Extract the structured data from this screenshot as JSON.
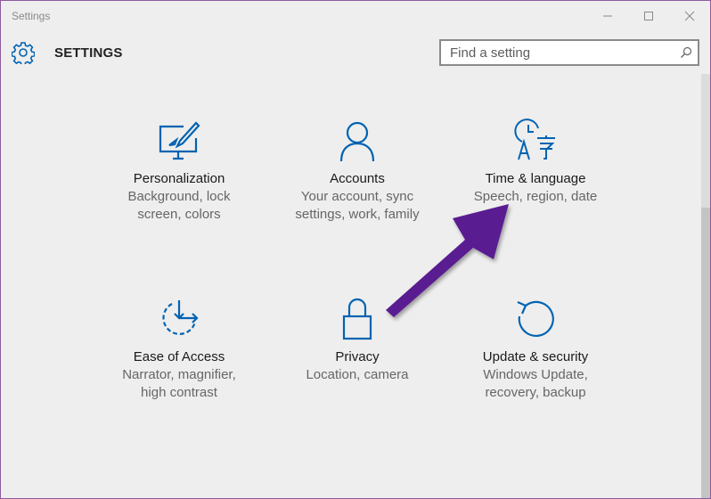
{
  "window": {
    "title": "Settings",
    "controls": [
      "minimize",
      "maximize",
      "close"
    ]
  },
  "header": {
    "title": "SETTINGS",
    "icon": "gear-icon",
    "search": {
      "placeholder": "Find a setting",
      "value": ""
    }
  },
  "tiles": [
    {
      "icon": "personalization-icon",
      "title": "Personalization",
      "desc1": "Background, lock",
      "desc2": "screen, colors"
    },
    {
      "icon": "accounts-icon",
      "title": "Accounts",
      "desc1": "Your account, sync",
      "desc2": "settings, work, family"
    },
    {
      "icon": "time-language-icon",
      "title": "Time & language",
      "desc1": "Speech, region, date",
      "desc2": ""
    },
    {
      "icon": "ease-of-access-icon",
      "title": "Ease of Access",
      "desc1": "Narrator, magnifier,",
      "desc2": "high contrast"
    },
    {
      "icon": "privacy-lock-icon",
      "title": "Privacy",
      "desc1": "Location, camera",
      "desc2": ""
    },
    {
      "icon": "update-security-icon",
      "title": "Update & security",
      "desc1": "Windows Update,",
      "desc2": "recovery, backup"
    }
  ],
  "colors": {
    "accent": "#0063b1",
    "annotation_arrow": "#5a1d91"
  }
}
